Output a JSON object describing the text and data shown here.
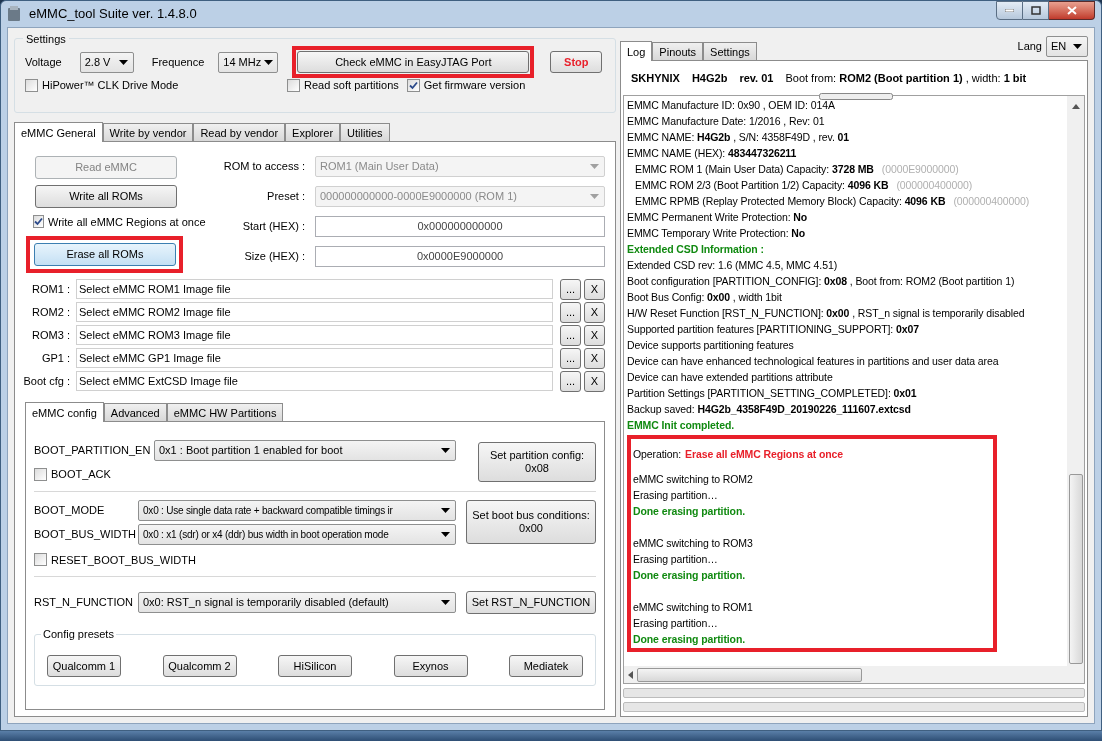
{
  "window": {
    "title": "eMMC_tool Suite  ver. 1.4.8.0"
  },
  "settings": {
    "title": "Settings",
    "voltage": {
      "label": "Voltage",
      "value": "2.8 V"
    },
    "frequence": {
      "label": "Frequence",
      "value": "14 MHz"
    },
    "check_button": {
      "label": "Check eMMC in EasyJTAG Port",
      "highlighted": true
    },
    "stop_button": {
      "label": "Stop"
    },
    "checkboxes": [
      {
        "label": "HiPower™ CLK Drive Mode",
        "checked": false
      },
      {
        "label": "Read soft partitions",
        "checked": false
      },
      {
        "label": "Get firmware version",
        "checked": true
      }
    ]
  },
  "main_tabs": [
    {
      "label": "eMMC General",
      "selected": true
    },
    {
      "label": "Write by vendor",
      "selected": false
    },
    {
      "label": "Read by vendor",
      "selected": false
    },
    {
      "label": "Explorer",
      "selected": false
    },
    {
      "label": "Utilities",
      "selected": false
    }
  ],
  "general": {
    "read_button": {
      "label": "Read eMMC",
      "disabled": true
    },
    "write_button": {
      "label": "Write all ROMs",
      "disabled": false
    },
    "write_all_regions": {
      "label": "Write all eMMC Regions at once",
      "checked": true
    },
    "erase_button": {
      "label": "Erase all ROMs",
      "highlighted": true
    },
    "fields": [
      {
        "label": "ROM to access :",
        "value": "ROM1 (Main User Data)",
        "kind": "combo",
        "disabled": true
      },
      {
        "label": "Preset :",
        "value": "000000000000-0000E9000000 (ROM 1)",
        "kind": "combo",
        "disabled": true
      },
      {
        "label": "Start (HEX) :",
        "value": "0x000000000000",
        "kind": "text",
        "disabled": false
      },
      {
        "label": "Size (HEX) :",
        "value": "0x0000E9000000",
        "kind": "text",
        "disabled": false
      }
    ],
    "files": [
      {
        "label": "ROM1 :",
        "value": "Select eMMC ROM1 Image file",
        "browse": "...",
        "clear": "X"
      },
      {
        "label": "ROM2 :",
        "value": "Select eMMC ROM2 Image file",
        "browse": "...",
        "clear": "X"
      },
      {
        "label": "ROM3 :",
        "value": "Select eMMC ROM3 Image file",
        "browse": "...",
        "clear": "X"
      },
      {
        "label": "GP1 :",
        "value": "Select eMMC GP1 Image file",
        "browse": "...",
        "clear": "X"
      },
      {
        "label": "Boot cfg :",
        "value": "Select eMMC ExtCSD Image file",
        "browse": "...",
        "clear": "X"
      }
    ]
  },
  "config_tabs": [
    {
      "label": "eMMC config",
      "selected": true
    },
    {
      "label": "Advanced",
      "selected": false
    },
    {
      "label": "eMMC HW Partitions",
      "selected": false
    }
  ],
  "config": {
    "boot_partition": {
      "label": "BOOT_PARTITION_EN",
      "value": "0x1 : Boot partition 1 enabled for boot",
      "checkbox": {
        "label": "BOOT_ACK",
        "checked": false
      },
      "button": [
        "Set partition config:",
        "0x08"
      ]
    },
    "boot_bus": {
      "rows": [
        {
          "label": "BOOT_MODE",
          "value": "0x0 : Use single data rate + backward compatible timings ir"
        },
        {
          "label": "BOOT_BUS_WIDTH",
          "value": "0x0 : x1 (sdr) or x4 (ddr) bus width in boot operation mode"
        }
      ],
      "checkbox": {
        "label": "RESET_BOOT_BUS_WIDTH",
        "checked": false
      },
      "button": [
        "Set boot bus conditions:",
        "0x00"
      ]
    },
    "rst": {
      "label": "RST_N_FUNCTION",
      "value": "0x0: RST_n signal is temporarily disabled (default)",
      "button": "Set RST_N_FUNCTION"
    },
    "presets": {
      "title": "Config presets",
      "buttons": [
        "Qualcomm 1",
        "Qualcomm 2",
        "HiSilicon",
        "Exynos",
        "Mediatek"
      ]
    }
  },
  "log_tabs": [
    {
      "label": "Log",
      "selected": true
    },
    {
      "label": "Pinouts",
      "selected": false
    },
    {
      "label": "Settings",
      "selected": false
    }
  ],
  "lang": {
    "label": "Lang",
    "value": "EN"
  },
  "device_header": [
    {
      "text": "SKHYNIX",
      "bold": true
    },
    {
      "text": "H4G2b",
      "bold": true
    },
    {
      "text": "rev. 01",
      "bold": true
    },
    {
      "text": "Boot from:  **ROM2 (Boot partition 1)** , width: **1 bit**",
      "bold": false
    }
  ],
  "log": [
    {
      "text": "EMMC Manufacture ID: 0x90 , OEM ID: 014A",
      "kind": "plain"
    },
    {
      "text": "EMMC Manufacture Date: 1/2016 , Rev: 01",
      "kind": "plain"
    },
    {
      "text": "EMMC NAME: **H4G2b**  , S/N: 4358F49D , rev. **01**",
      "kind": "plain"
    },
    {
      "text": "EMMC NAME (HEX): **483447326211**",
      "kind": "plain"
    },
    {
      "text": "EMMC ROM 1 (Main User Data) Capacity: **3728 MB**",
      "note": "(0000E9000000)",
      "kind": "indent"
    },
    {
      "text": "EMMC ROM 2/3 (Boot Partition 1/2) Capacity: **4096 KB**",
      "note": "(000000400000)",
      "kind": "indent"
    },
    {
      "text": "EMMC RPMB (Replay Protected Memory Block) Capacity: **4096 KB**",
      "note": "(000000400000)",
      "kind": "indent"
    },
    {
      "text": "EMMC Permanent Write Protection: **No**",
      "kind": "plain"
    },
    {
      "text": "EMMC Temporary Write Protection: **No**",
      "kind": "plain"
    },
    {
      "text": "Extended CSD Information :",
      "kind": "success"
    },
    {
      "text": "Extended CSD rev: 1.6 (MMC 4.5, MMC 4.51)",
      "kind": "plain"
    },
    {
      "text": "Boot configuration [PARTITION_CONFIG]: **0x08**  , Boot from: ROM2 (Boot partition 1)",
      "kind": "plain"
    },
    {
      "text": "Boot Bus Config: **0x00**  , width 1bit",
      "kind": "plain"
    },
    {
      "text": "H/W Reset Function [RST_N_FUNCTION]: **0x00** , RST_n signal is temporarily disabled",
      "kind": "plain"
    },
    {
      "text": "Supported partition features [PARTITIONING_SUPPORT]: **0x07**",
      "kind": "plain"
    },
    {
      "text": "Device supports partitioning features",
      "kind": "plain"
    },
    {
      "text": "Device can have enhanced technological features in partitions and user data area",
      "kind": "plain"
    },
    {
      "text": "Device can have extended partitions attribute",
      "kind": "plain"
    },
    {
      "text": "Partition Settings [PARTITION_SETTING_COMPLETED]: **0x01**",
      "kind": "plain"
    },
    {
      "text": "Backup saved: **H4G2b_4358F49D_20190226_111607.extcsd**",
      "kind": "plain"
    },
    {
      "text": "EMMC Init completed.",
      "kind": "success"
    }
  ],
  "operation_log": {
    "highlighted": true,
    "operation": {
      "label": "Operation:",
      "value": "Erase all eMMC Regions at once"
    },
    "groups": [
      [
        {
          "text": "eMMC switching to ROM2",
          "kind": "plain"
        },
        {
          "text": "Erasing partition…",
          "kind": "plain"
        },
        {
          "text": "Done erasing partition.",
          "kind": "success"
        }
      ],
      [
        {
          "text": "eMMC switching to ROM3",
          "kind": "plain"
        },
        {
          "text": "Erasing partition…",
          "kind": "plain"
        },
        {
          "text": "Done erasing partition.",
          "kind": "success"
        }
      ],
      [
        {
          "text": "eMMC switching to ROM1",
          "kind": "plain"
        },
        {
          "text": "Erasing partition…",
          "kind": "plain"
        },
        {
          "text": "Done erasing partition.",
          "kind": "success"
        }
      ]
    ]
  },
  "progress_bars": [
    {
      "level": 0
    },
    {
      "level": 0
    }
  ]
}
